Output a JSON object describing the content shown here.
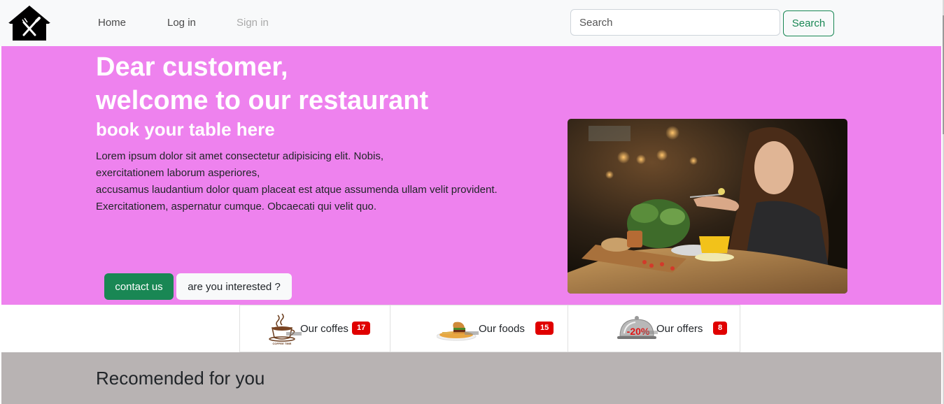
{
  "nav": {
    "home": "Home",
    "login": "Log in",
    "signin": "Sign in",
    "search_placeholder": "Search",
    "search_button": "Search"
  },
  "hero": {
    "title_line1": "Dear customer,",
    "title_line2": "welcome to our restaurant",
    "subtitle": "book your table here",
    "text_line1": "Lorem ipsum dolor sit amet consectetur adipisicing elit. Nobis,",
    "text_line2": "exercitationem laborum asperiores,",
    "text_line3": "accusamus laudantium dolor quam placeat est atque assumenda ullam velit provident.",
    "text_line4": "Exercitationem, aspernatur cumque. Obcaecati qui velit quo.",
    "contact_button": "contact us",
    "interest_button": "are you interested ?"
  },
  "categories": [
    {
      "label": "Our coffes",
      "count": "17",
      "icon_text": "COFFEE TIME"
    },
    {
      "label": "Our foods",
      "count": "15"
    },
    {
      "label": "Our offers",
      "count": "8",
      "icon_text": "-20%"
    }
  ],
  "recommended": {
    "title": "Recomended for you"
  },
  "colors": {
    "hero_bg": "#ee82ee",
    "success": "#198754",
    "badge": "#e00000",
    "recommended_bg": "#b8b3b3"
  }
}
